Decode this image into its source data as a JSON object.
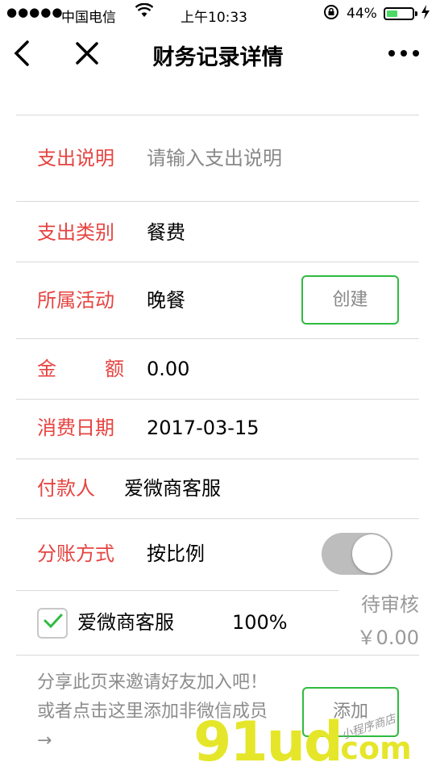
{
  "status_bar": {
    "signal": "●●●●●",
    "carrier": "中国电信",
    "wifi_icon": "wifi-icon",
    "time": "上午10:33",
    "lock_icon": "rotation-lock-icon",
    "battery_percent": "44%",
    "battery_level": 0.44,
    "charging_icon": "bolt-icon"
  },
  "nav": {
    "back_icon": "chevron-left-icon",
    "close_icon": "close-icon",
    "title": "财务记录详情",
    "more_icon": "more-dots-icon"
  },
  "form": {
    "description": {
      "label": "支出说明",
      "placeholder": "请输入支出说明",
      "value": ""
    },
    "category": {
      "label": "支出类别",
      "value": "餐费"
    },
    "activity": {
      "label": "所属活动",
      "value": "晚餐",
      "button": "创建"
    },
    "amount": {
      "label_left": "金",
      "label_right": "额",
      "value": "0.00"
    },
    "date": {
      "label": "消费日期",
      "value": "2017-03-15"
    },
    "payer": {
      "label": "付款人",
      "value": "爱微商客服"
    },
    "split": {
      "label": "分账方式",
      "value": "按比例",
      "toggle_on": false
    }
  },
  "member": {
    "checked": true,
    "name": "爱微商客服",
    "percent": "100%",
    "status": "待审核",
    "amount": "￥0.00"
  },
  "footer": {
    "hint": "分享此页来邀请好友加入吧！或者点击这里添加非微信成员→",
    "add_button": "添加"
  },
  "watermark": {
    "logo": "91ud",
    "suffix": ".com",
    "tagline": "小程序商店"
  },
  "colors": {
    "label_red": "#e64340",
    "accent_green": "#2fbb3f",
    "divider": "#d9d9d9"
  }
}
